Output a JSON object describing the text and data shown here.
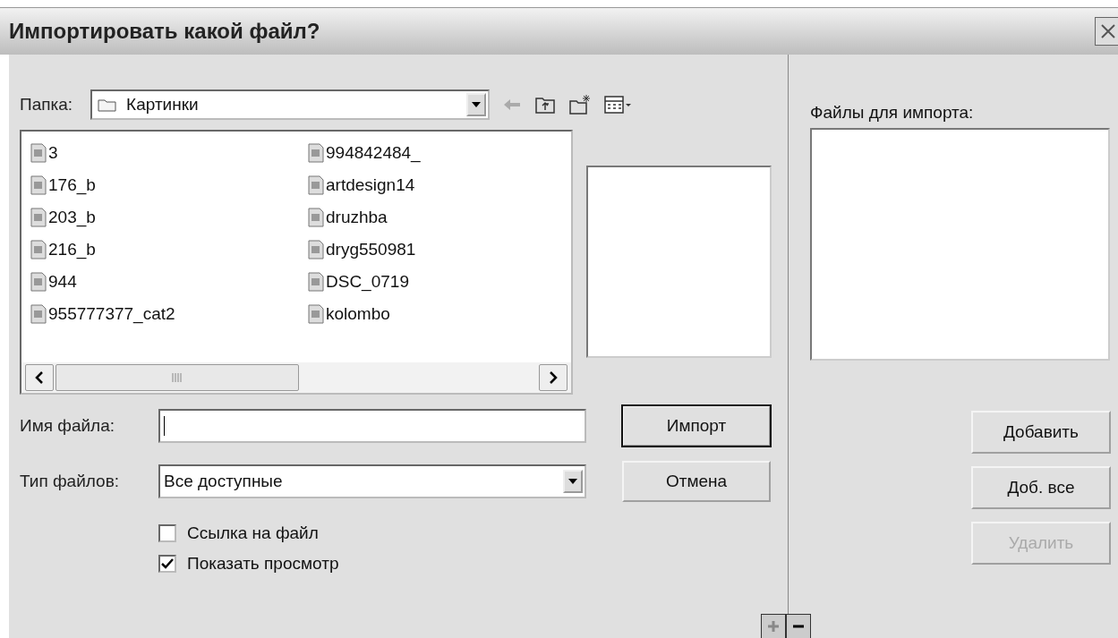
{
  "window": {
    "title": "Импортировать какой файл?"
  },
  "folder": {
    "label": "Папка:",
    "value": "Картинки"
  },
  "files": [
    "3",
    "176_b",
    "203_b",
    "216_b",
    "944",
    "955777377_cat2",
    "994842484_",
    "artdesign14",
    "druzhba",
    "dryg550981",
    "DSC_0719",
    "kolombo"
  ],
  "file_name": {
    "label": "Имя файла:"
  },
  "file_type": {
    "label": "Тип файлов:",
    "value": "Все доступные"
  },
  "options": [
    {
      "label": "Ссылка на файл",
      "checked": false
    },
    {
      "label": "Показать просмотр",
      "checked": true
    }
  ],
  "buttons": [
    {
      "label": "Импорт",
      "default": true
    },
    {
      "label": "Отмена",
      "default": false
    }
  ],
  "import_list": {
    "label": "Файлы для импорта:"
  },
  "list_buttons": [
    {
      "label": "Добавить",
      "disabled": false
    },
    {
      "label": "Доб. все",
      "disabled": false
    },
    {
      "label": "Удалить",
      "disabled": true
    }
  ]
}
